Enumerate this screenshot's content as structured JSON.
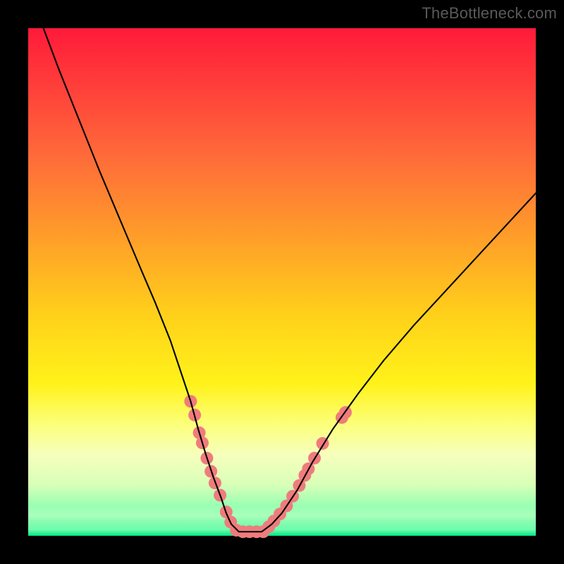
{
  "watermark": "TheBottleneck.com",
  "chart_data": {
    "type": "line",
    "title": "",
    "xlabel": "",
    "ylabel": "",
    "xlim": [
      0,
      100
    ],
    "ylim": [
      0,
      100
    ],
    "grid": false,
    "legend": false,
    "series": [
      {
        "name": "curve",
        "color": "#000000",
        "x": [
          3,
          6,
          10,
          14,
          18,
          22,
          25,
          28,
          30,
          32,
          33.5,
          35,
          36.5,
          38,
          39,
          40,
          41.5,
          46,
          48,
          50,
          53,
          56,
          60,
          65,
          70,
          76,
          82,
          88,
          94,
          100
        ],
        "y": [
          100,
          92,
          82,
          72,
          62.5,
          53,
          46,
          38.5,
          32.5,
          26.5,
          21,
          16,
          11.5,
          7.5,
          4.5,
          2.3,
          0.8,
          0.8,
          2.3,
          4.5,
          9,
          14.5,
          21,
          28,
          34.5,
          41.5,
          48,
          54.5,
          61,
          67.5
        ]
      }
    ],
    "markers": [
      {
        "name": "beads",
        "color": "#ef7c7c",
        "radius_px": 9,
        "points": [
          {
            "x": 32.0,
            "y": 26.5
          },
          {
            "x": 32.8,
            "y": 23.8
          },
          {
            "x": 33.7,
            "y": 20.3
          },
          {
            "x": 34.3,
            "y": 18.3
          },
          {
            "x": 35.2,
            "y": 15.3
          },
          {
            "x": 36.0,
            "y": 12.7
          },
          {
            "x": 36.8,
            "y": 10.4
          },
          {
            "x": 37.8,
            "y": 8.0
          },
          {
            "x": 39.0,
            "y": 4.7
          },
          {
            "x": 39.9,
            "y": 2.7
          },
          {
            "x": 41.0,
            "y": 1.1
          },
          {
            "x": 42.3,
            "y": 0.8
          },
          {
            "x": 43.6,
            "y": 0.8
          },
          {
            "x": 45.0,
            "y": 0.8
          },
          {
            "x": 46.3,
            "y": 0.8
          },
          {
            "x": 47.4,
            "y": 1.8
          },
          {
            "x": 48.4,
            "y": 2.9
          },
          {
            "x": 49.6,
            "y": 4.3
          },
          {
            "x": 50.9,
            "y": 5.9
          },
          {
            "x": 52.1,
            "y": 7.8
          },
          {
            "x": 53.4,
            "y": 9.9
          },
          {
            "x": 54.5,
            "y": 11.9
          },
          {
            "x": 55.2,
            "y": 13.2
          },
          {
            "x": 56.4,
            "y": 15.3
          },
          {
            "x": 58.0,
            "y": 18.2
          },
          {
            "x": 61.8,
            "y": 23.3
          },
          {
            "x": 62.5,
            "y": 24.3
          }
        ]
      }
    ]
  }
}
